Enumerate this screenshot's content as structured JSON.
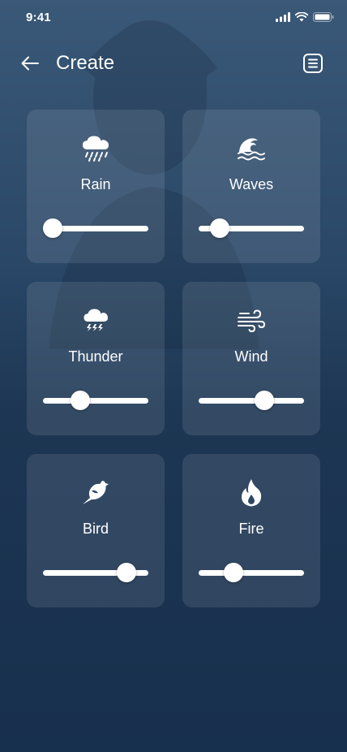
{
  "status": {
    "time": "9:41"
  },
  "header": {
    "title": "Create"
  },
  "cards": [
    {
      "label": "Rain",
      "icon": "rain-cloud-icon",
      "level": 0.09
    },
    {
      "label": "Waves",
      "icon": "waves-icon",
      "level": 0.2
    },
    {
      "label": "Thunder",
      "icon": "thunder-cloud-icon",
      "level": 0.35
    },
    {
      "label": "Wind",
      "icon": "wind-icon",
      "level": 0.62
    },
    {
      "label": "Bird",
      "icon": "bird-icon",
      "level": 0.79
    },
    {
      "label": "Fire",
      "icon": "fire-icon",
      "level": 0.33
    }
  ],
  "colors": {
    "background_top": "#3a5877",
    "background_bottom": "#17304d",
    "card": "rgba(255,255,255,0.10)",
    "accent": "#ffffff"
  }
}
